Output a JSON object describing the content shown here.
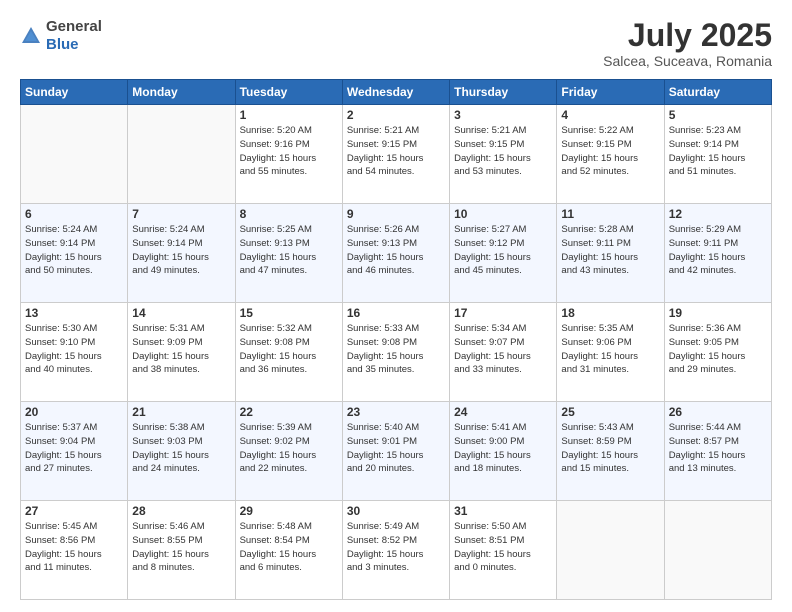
{
  "header": {
    "logo_general": "General",
    "logo_blue": "Blue",
    "title": "July 2025",
    "location": "Salcea, Suceava, Romania"
  },
  "weekdays": [
    "Sunday",
    "Monday",
    "Tuesday",
    "Wednesday",
    "Thursday",
    "Friday",
    "Saturday"
  ],
  "weeks": [
    [
      {
        "day": "",
        "info": ""
      },
      {
        "day": "",
        "info": ""
      },
      {
        "day": "1",
        "info": "Sunrise: 5:20 AM\nSunset: 9:16 PM\nDaylight: 15 hours\nand 55 minutes."
      },
      {
        "day": "2",
        "info": "Sunrise: 5:21 AM\nSunset: 9:15 PM\nDaylight: 15 hours\nand 54 minutes."
      },
      {
        "day": "3",
        "info": "Sunrise: 5:21 AM\nSunset: 9:15 PM\nDaylight: 15 hours\nand 53 minutes."
      },
      {
        "day": "4",
        "info": "Sunrise: 5:22 AM\nSunset: 9:15 PM\nDaylight: 15 hours\nand 52 minutes."
      },
      {
        "day": "5",
        "info": "Sunrise: 5:23 AM\nSunset: 9:14 PM\nDaylight: 15 hours\nand 51 minutes."
      }
    ],
    [
      {
        "day": "6",
        "info": "Sunrise: 5:24 AM\nSunset: 9:14 PM\nDaylight: 15 hours\nand 50 minutes."
      },
      {
        "day": "7",
        "info": "Sunrise: 5:24 AM\nSunset: 9:14 PM\nDaylight: 15 hours\nand 49 minutes."
      },
      {
        "day": "8",
        "info": "Sunrise: 5:25 AM\nSunset: 9:13 PM\nDaylight: 15 hours\nand 47 minutes."
      },
      {
        "day": "9",
        "info": "Sunrise: 5:26 AM\nSunset: 9:13 PM\nDaylight: 15 hours\nand 46 minutes."
      },
      {
        "day": "10",
        "info": "Sunrise: 5:27 AM\nSunset: 9:12 PM\nDaylight: 15 hours\nand 45 minutes."
      },
      {
        "day": "11",
        "info": "Sunrise: 5:28 AM\nSunset: 9:11 PM\nDaylight: 15 hours\nand 43 minutes."
      },
      {
        "day": "12",
        "info": "Sunrise: 5:29 AM\nSunset: 9:11 PM\nDaylight: 15 hours\nand 42 minutes."
      }
    ],
    [
      {
        "day": "13",
        "info": "Sunrise: 5:30 AM\nSunset: 9:10 PM\nDaylight: 15 hours\nand 40 minutes."
      },
      {
        "day": "14",
        "info": "Sunrise: 5:31 AM\nSunset: 9:09 PM\nDaylight: 15 hours\nand 38 minutes."
      },
      {
        "day": "15",
        "info": "Sunrise: 5:32 AM\nSunset: 9:08 PM\nDaylight: 15 hours\nand 36 minutes."
      },
      {
        "day": "16",
        "info": "Sunrise: 5:33 AM\nSunset: 9:08 PM\nDaylight: 15 hours\nand 35 minutes."
      },
      {
        "day": "17",
        "info": "Sunrise: 5:34 AM\nSunset: 9:07 PM\nDaylight: 15 hours\nand 33 minutes."
      },
      {
        "day": "18",
        "info": "Sunrise: 5:35 AM\nSunset: 9:06 PM\nDaylight: 15 hours\nand 31 minutes."
      },
      {
        "day": "19",
        "info": "Sunrise: 5:36 AM\nSunset: 9:05 PM\nDaylight: 15 hours\nand 29 minutes."
      }
    ],
    [
      {
        "day": "20",
        "info": "Sunrise: 5:37 AM\nSunset: 9:04 PM\nDaylight: 15 hours\nand 27 minutes."
      },
      {
        "day": "21",
        "info": "Sunrise: 5:38 AM\nSunset: 9:03 PM\nDaylight: 15 hours\nand 24 minutes."
      },
      {
        "day": "22",
        "info": "Sunrise: 5:39 AM\nSunset: 9:02 PM\nDaylight: 15 hours\nand 22 minutes."
      },
      {
        "day": "23",
        "info": "Sunrise: 5:40 AM\nSunset: 9:01 PM\nDaylight: 15 hours\nand 20 minutes."
      },
      {
        "day": "24",
        "info": "Sunrise: 5:41 AM\nSunset: 9:00 PM\nDaylight: 15 hours\nand 18 minutes."
      },
      {
        "day": "25",
        "info": "Sunrise: 5:43 AM\nSunset: 8:59 PM\nDaylight: 15 hours\nand 15 minutes."
      },
      {
        "day": "26",
        "info": "Sunrise: 5:44 AM\nSunset: 8:57 PM\nDaylight: 15 hours\nand 13 minutes."
      }
    ],
    [
      {
        "day": "27",
        "info": "Sunrise: 5:45 AM\nSunset: 8:56 PM\nDaylight: 15 hours\nand 11 minutes."
      },
      {
        "day": "28",
        "info": "Sunrise: 5:46 AM\nSunset: 8:55 PM\nDaylight: 15 hours\nand 8 minutes."
      },
      {
        "day": "29",
        "info": "Sunrise: 5:48 AM\nSunset: 8:54 PM\nDaylight: 15 hours\nand 6 minutes."
      },
      {
        "day": "30",
        "info": "Sunrise: 5:49 AM\nSunset: 8:52 PM\nDaylight: 15 hours\nand 3 minutes."
      },
      {
        "day": "31",
        "info": "Sunrise: 5:50 AM\nSunset: 8:51 PM\nDaylight: 15 hours\nand 0 minutes."
      },
      {
        "day": "",
        "info": ""
      },
      {
        "day": "",
        "info": ""
      }
    ]
  ]
}
